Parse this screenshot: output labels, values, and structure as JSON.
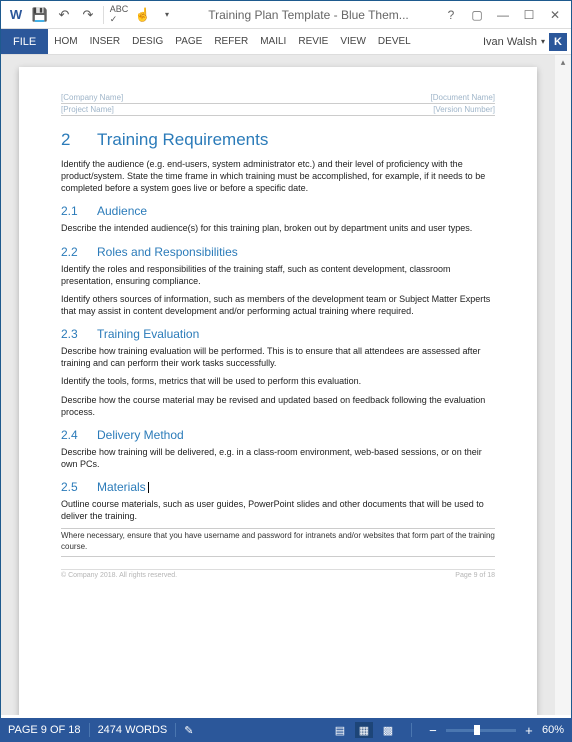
{
  "window": {
    "title": "Training Plan Template - Blue Them..."
  },
  "qat": {
    "word": "W",
    "save": "💾",
    "undo": "↶",
    "redo": "↷",
    "spell": "✓",
    "touch": "☝",
    "more": "▾"
  },
  "wincontrols": {
    "help": "?",
    "ribbonopt": "▢",
    "min": "—",
    "max": "☐",
    "close": "✕"
  },
  "tabs": {
    "file": "FILE",
    "home": "HOM",
    "insert": "INSER",
    "design": "DESIG",
    "page": "PAGE",
    "refer": "REFER",
    "mail": "MAILI",
    "review": "REVIE",
    "view": "VIEW",
    "devel": "DEVEL"
  },
  "user": {
    "name": "Ivan Walsh",
    "initial": "K"
  },
  "doc": {
    "header": {
      "company": "[Company Name]",
      "docname": "[Document Name]",
      "project": "[Project Name]",
      "version": "[Version Number]"
    },
    "h1_num": "2",
    "h1_title": "Training Requirements",
    "intro": "Identify the audience (e.g. end-users, system administrator etc.) and their level of proficiency with the product/system. State the time frame in which training must be accomplished, for example, if it needs to be completed before a system goes live or before a specific date.",
    "s21_num": "2.1",
    "s21_title": "Audience",
    "s21_body": "Describe the intended audience(s) for this training plan, broken out by department units and user types.",
    "s22_num": "2.2",
    "s22_title": "Roles and Responsibilities",
    "s22_body1": "Identify the roles and responsibilities of the training staff, such as content development, classroom presentation, ensuring compliance.",
    "s22_body2": "Identify others sources of information, such as members of the development team or Subject Matter Experts that may assist in content development and/or performing actual training where required.",
    "s23_num": "2.3",
    "s23_title": "Training Evaluation",
    "s23_body1": "Describe how training evaluation will be performed. This is to ensure that all attendees are assessed after training and can perform their work tasks successfully.",
    "s23_body2": "Identify the tools, forms, metrics that will be used to perform this evaluation.",
    "s23_body3": "Describe how the course material may be revised and updated based on feedback following the evaluation process.",
    "s24_num": "2.4",
    "s24_title": "Delivery Method",
    "s24_body": "Describe how training will be delivered, e.g. in a class-room environment, web-based sessions, or on their own PCs.",
    "s25_num": "2.5",
    "s25_title": "Materials",
    "s25_body": "Outline course materials, such as user guides, PowerPoint slides and other documents that will be used to deliver the training.",
    "footnote": "Where necessary, ensure that you have username and password for intranets and/or websites that form part of the training course.",
    "footer": {
      "copyright": "© Company 2018. All rights reserved.",
      "page": "Page 9 of 18"
    }
  },
  "status": {
    "page": "PAGE 9 OF 18",
    "words": "2474 WORDS",
    "proof": "✎",
    "zoom": "60%",
    "minus": "−",
    "plus": "+"
  }
}
